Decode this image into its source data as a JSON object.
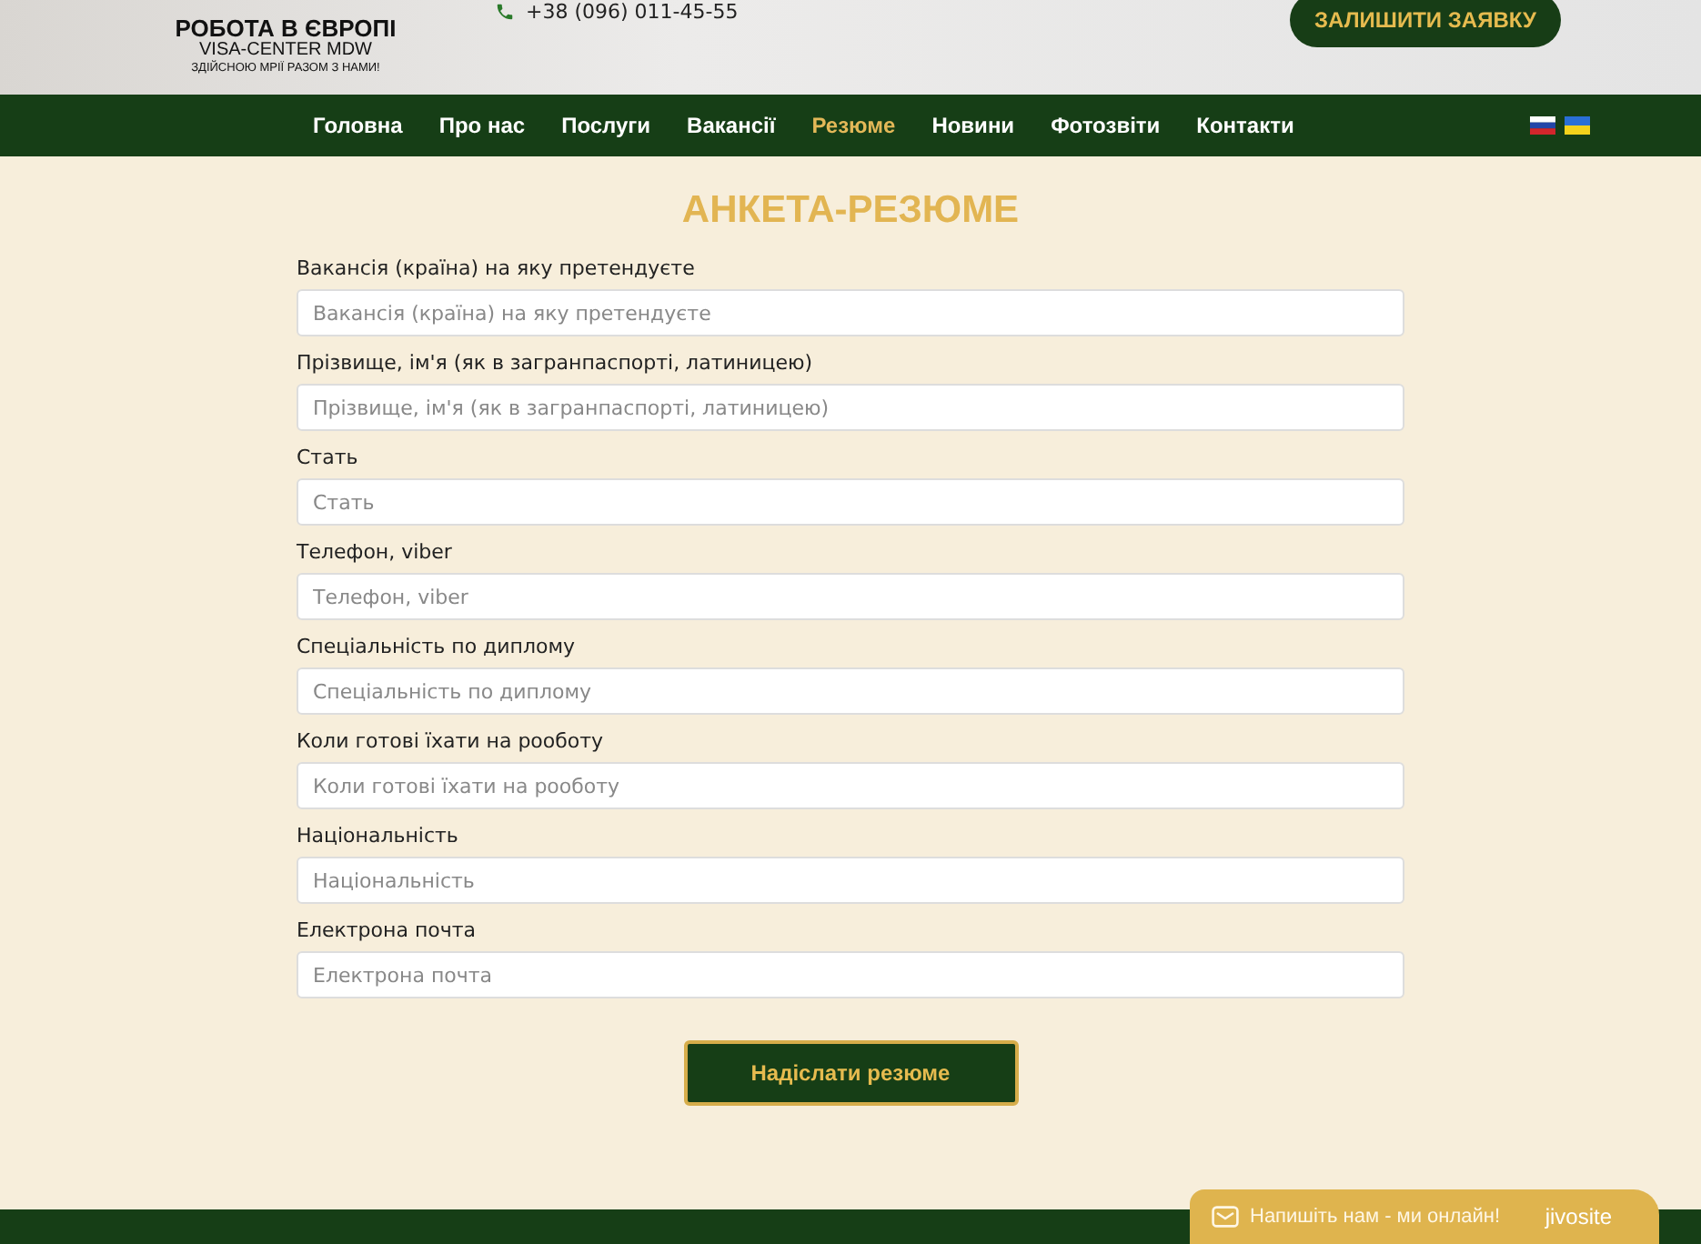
{
  "header": {
    "logo": {
      "title": "РОБОТА В ЄВРОПІ",
      "subtitle": "VISA-CENTER MDW",
      "tagline": "ЗДІЙСНОЮ МРІЇ РАЗОМ З НАМИ!"
    },
    "phone": "+38 (096) 011-45-55",
    "cta": "ЗАЛИШИТИ ЗАЯВКУ"
  },
  "nav": {
    "items": [
      {
        "label": "Головна",
        "selected": false
      },
      {
        "label": "Про нас",
        "selected": false
      },
      {
        "label": "Послуги",
        "selected": false
      },
      {
        "label": "Вакансії",
        "selected": false
      },
      {
        "label": "Резюме",
        "selected": true
      },
      {
        "label": "Новини",
        "selected": false
      },
      {
        "label": "Фотозвіти",
        "selected": false
      },
      {
        "label": "Контакти",
        "selected": false
      }
    ],
    "languages": [
      {
        "kind": "tricolor"
      },
      {
        "kind": "bicolor"
      }
    ]
  },
  "form": {
    "title": "АНКЕТА-РЕЗЮМЕ",
    "fields": [
      {
        "label": "Вакансія (країна) на яку претендуєте",
        "placeholder": "Вакансія (країна) на яку претендуєте"
      },
      {
        "label": "Прізвище, ім'я (як в загранпаспорті, латиницею)",
        "placeholder": "Прізвище, ім'я (як в загранпаспорті, латиницею)"
      },
      {
        "label": "Стать",
        "placeholder": "Стать"
      },
      {
        "label": "Телефон, viber",
        "placeholder": "Телефон, viber"
      },
      {
        "label": "Спеціальність по диплому",
        "placeholder": "Спеціальність по диплому"
      },
      {
        "label": "Коли готові їхати на рооботу",
        "placeholder": "Коли готові їхати на рооботу"
      },
      {
        "label": "Національність",
        "placeholder": "Національність"
      },
      {
        "label": "Електрона почта",
        "placeholder": "Електрона почта"
      }
    ],
    "submit": "Надіслати резюме"
  },
  "chat": {
    "text": "Напишіть нам - ми онлайн!",
    "brand": "jivosite"
  }
}
